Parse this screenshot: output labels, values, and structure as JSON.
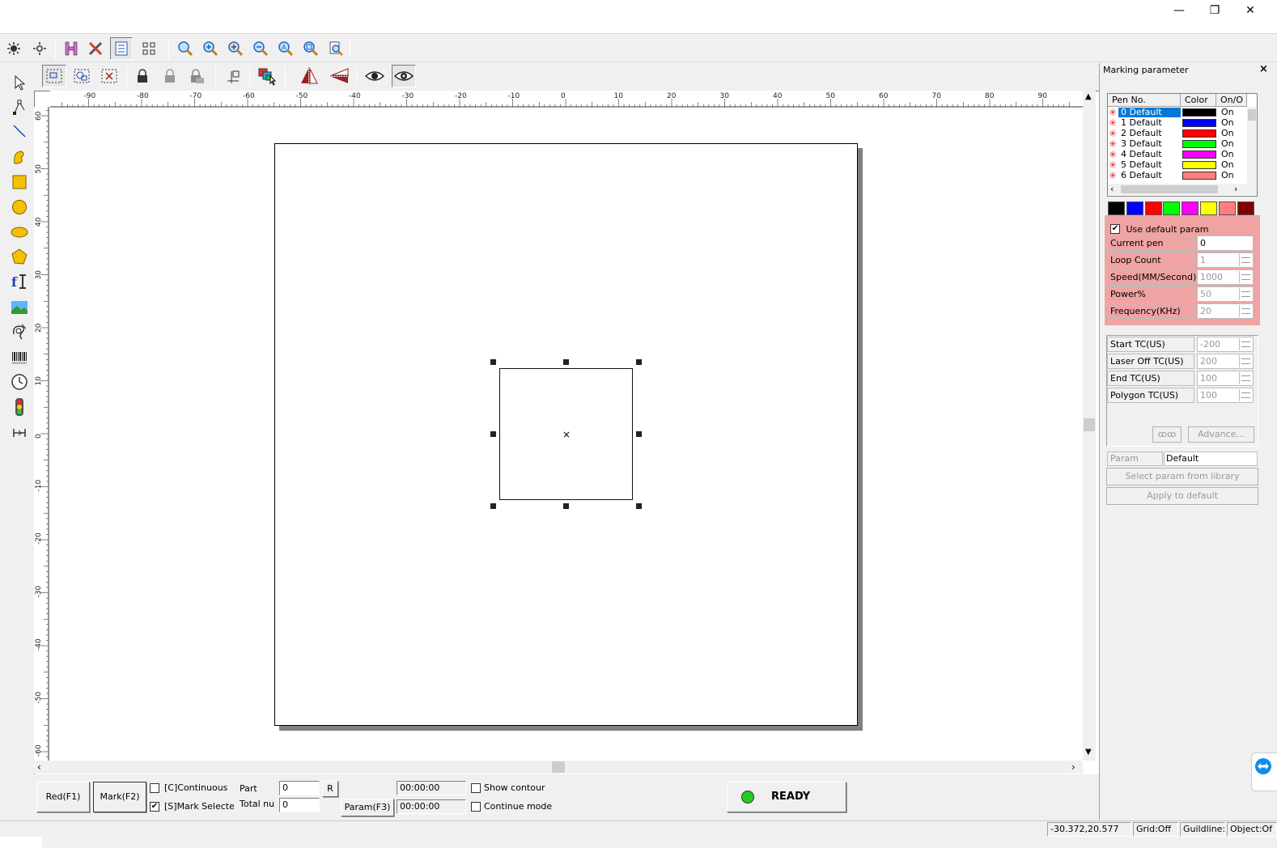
{
  "window": {
    "minimize": "—",
    "maximize": "❐",
    "close": "✕"
  },
  "toolbar_top": {
    "icons": [
      "select-all-icon",
      "invert-select-icon",
      "h-text-icon",
      "tools-icon",
      "layer-list-icon",
      "node-align-icon",
      "zoom-icon",
      "zoom-in-icon",
      "zoom-in-plus-icon",
      "zoom-out-icon",
      "zoom-fit-icon",
      "zoom-window-icon",
      "zoom-page-icon"
    ]
  },
  "toolbar_second": {
    "icons": [
      "group-icon",
      "ungroup-icon",
      "unselect-icon",
      "lock-icon",
      "unlock-icon",
      "lock-all-icon",
      "move-origin-icon",
      "color-layer-icon",
      "mirror-horizontal-icon",
      "mirror-vertical-icon",
      "preview-eye-icon",
      "preview-eye-2-icon"
    ]
  },
  "left_tools": [
    "pointer-icon",
    "node-edit-icon",
    "line-icon",
    "curve-icon",
    "rectangle-icon",
    "circle-icon",
    "ellipse-icon",
    "polygon-icon",
    "text-icon",
    "bitmap-icon",
    "vector-file-icon",
    "barcode-icon",
    "timer-icon",
    "input-port-icon",
    "output-port-icon"
  ],
  "ruler": {
    "h_labels": [
      "-90",
      "-80",
      "-70",
      "-60",
      "-50",
      "-40",
      "-30",
      "-20",
      "-10",
      "0",
      "10",
      "20",
      "30",
      "40",
      "50",
      "60",
      "70",
      "80",
      "90"
    ],
    "v_labels": [
      "60",
      "50",
      "40",
      "30",
      "20",
      "10",
      "0",
      "-10",
      "-20",
      "-30",
      "-40",
      "-50",
      "-60"
    ]
  },
  "marking_panel": {
    "title": "Marking parameter",
    "close": "×",
    "pen_headers": [
      "Pen No.",
      "Color",
      "On/O"
    ],
    "pens": [
      {
        "label": "0 Default",
        "color": "#000000",
        "state": "On",
        "selected": true
      },
      {
        "label": "1 Default",
        "color": "#0000ff",
        "state": "On"
      },
      {
        "label": "2 Default",
        "color": "#ff0000",
        "state": "On"
      },
      {
        "label": "3 Default",
        "color": "#00ff00",
        "state": "On"
      },
      {
        "label": "4 Default",
        "color": "#ff00ff",
        "state": "On"
      },
      {
        "label": "5 Default",
        "color": "#ffff00",
        "state": "On"
      },
      {
        "label": "6 Default",
        "color": "#ff7f7f",
        "state": "On"
      }
    ],
    "palette": [
      "#000000",
      "#0000ff",
      "#ff0000",
      "#00ff00",
      "#ff00ff",
      "#ffff00",
      "#ff7f7f",
      "#800000"
    ],
    "use_default_param": "Use default param",
    "params": [
      {
        "label": "Current pen",
        "value": "0",
        "spin": false
      },
      {
        "label": "Loop Count",
        "value": "1",
        "spin": true
      },
      {
        "label": "Speed(MM/Second)",
        "value": "1000",
        "spin": true
      },
      {
        "label": "Power%",
        "value": "50",
        "spin": true
      },
      {
        "label": "Frequency(KHz)",
        "value": "20",
        "spin": true
      }
    ],
    "tc_params": [
      {
        "label": "Start TC(US)",
        "value": "-200"
      },
      {
        "label": "Laser Off TC(US)",
        "value": "200"
      },
      {
        "label": "End TC(US)",
        "value": "100"
      },
      {
        "label": "Polygon TC(US)",
        "value": "100"
      }
    ],
    "loop_icon": "ꝏꝏ",
    "advance": "Advance...",
    "param_name_label": "Param name",
    "param_name_value": "Default",
    "select_from_library": "Select param from library",
    "apply_to_default": "Apply to default"
  },
  "bottom": {
    "red_button": "Red(F1)",
    "mark_button": "Mark(F2)",
    "continuous_label": "[C]Continuous",
    "mark_selected_label": "[S]Mark Selectec",
    "part_label": "Part",
    "part_value": "0",
    "r_button": "R",
    "total_label": "Total nu",
    "total_value": "0",
    "param_button": "Param(F3)",
    "time1": "00:00:00",
    "time2": "00:00:00",
    "show_contour": "Show contour",
    "continue_mode": "Continue mode",
    "status": "READY",
    "status_color": "#22cc22"
  },
  "statusbar": {
    "coords": "-30.372,20.577",
    "grid": "Grid:Off",
    "guideline": "Guildline:(",
    "object": "Object:Of"
  }
}
